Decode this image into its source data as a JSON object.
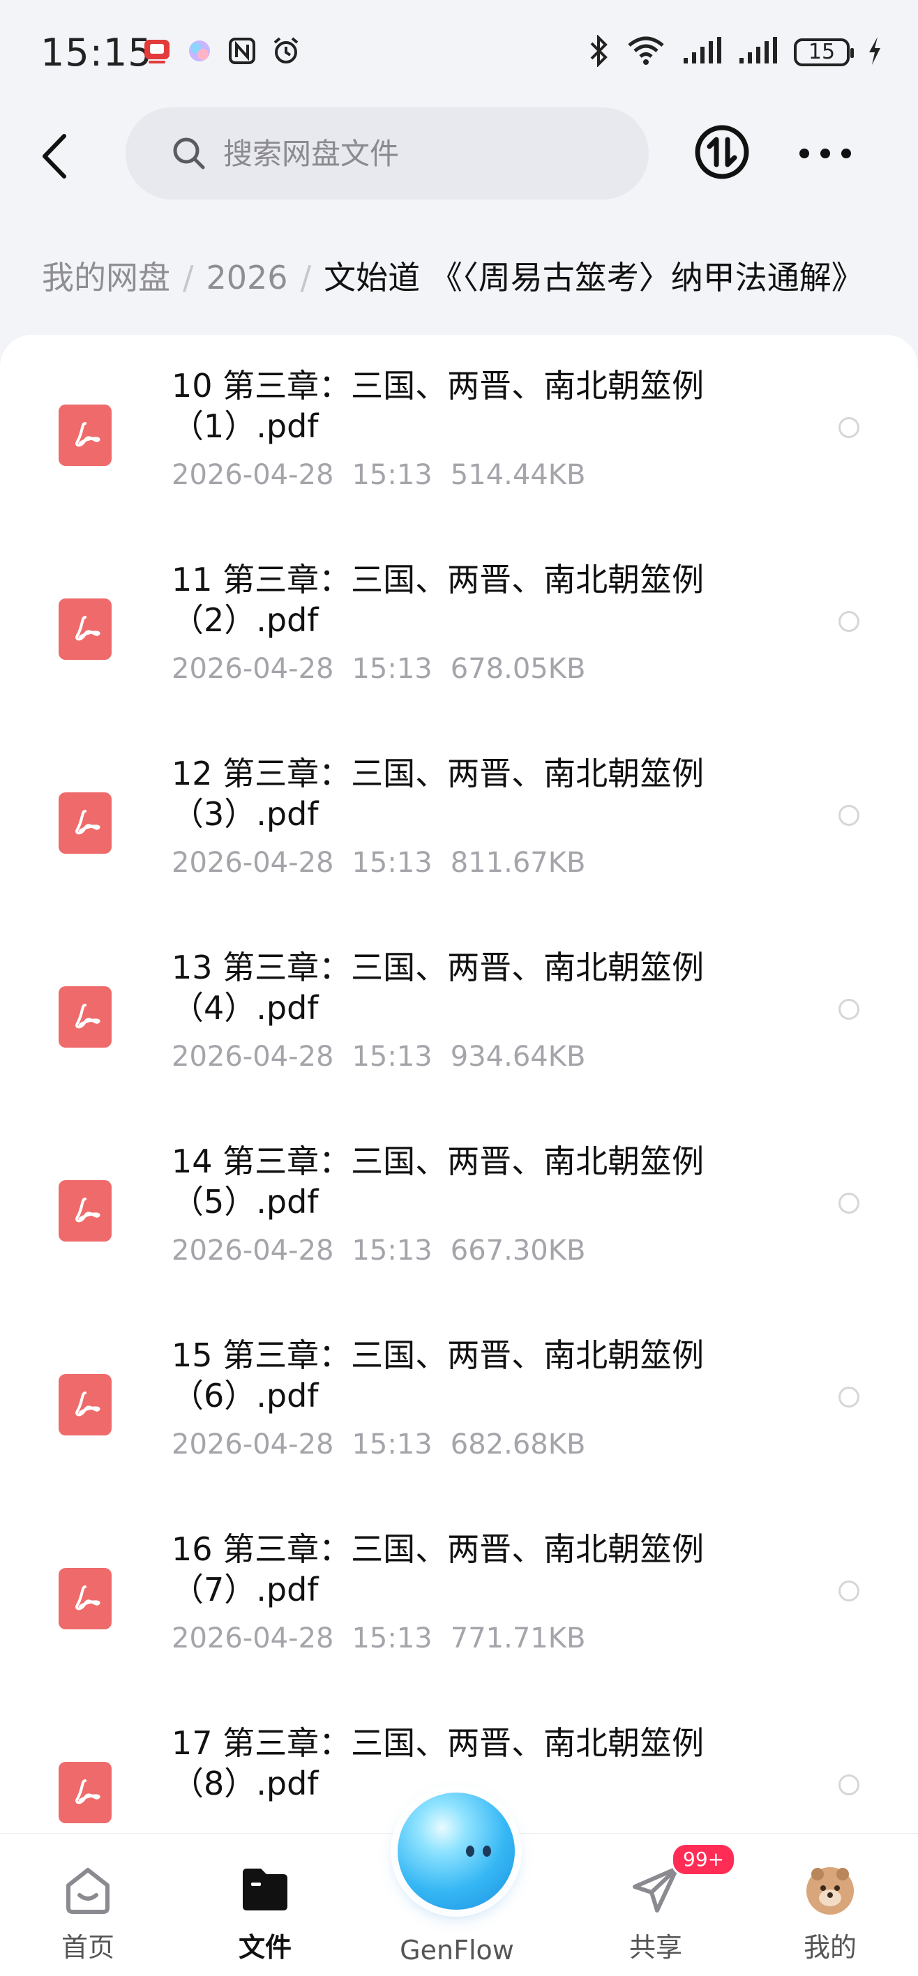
{
  "status_bar": {
    "time": "15:15",
    "battery_level": "15",
    "icons": [
      "app-notification-icon",
      "ai-assistant-icon",
      "nfc-icon",
      "alarm-icon",
      "bluetooth-icon",
      "wifi-icon",
      "signal-icon",
      "signal-icon",
      "battery-icon",
      "charging-icon"
    ]
  },
  "header": {
    "search_placeholder": "搜索网盘文件"
  },
  "breadcrumb": {
    "items": [
      "我的网盘",
      "2026"
    ],
    "current": "文始道 《〈周易古筮考〉纳甲法通解》"
  },
  "files": [
    {
      "name": "10 第三章：三国、两晋、南北朝筮例（1）.pdf",
      "date": "2026-04-28",
      "time": "15:13",
      "size": "514.44KB"
    },
    {
      "name": "11 第三章：三国、两晋、南北朝筮例（2）.pdf",
      "date": "2026-04-28",
      "time": "15:13",
      "size": "678.05KB"
    },
    {
      "name": "12 第三章：三国、两晋、南北朝筮例（3）.pdf",
      "date": "2026-04-28",
      "time": "15:13",
      "size": "811.67KB"
    },
    {
      "name": "13 第三章：三国、两晋、南北朝筮例（4）.pdf",
      "date": "2026-04-28",
      "time": "15:13",
      "size": "934.64KB"
    },
    {
      "name": "14 第三章：三国、两晋、南北朝筮例（5）.pdf",
      "date": "2026-04-28",
      "time": "15:13",
      "size": "667.30KB"
    },
    {
      "name": "15 第三章：三国、两晋、南北朝筮例（6）.pdf",
      "date": "2026-04-28",
      "time": "15:13",
      "size": "682.68KB"
    },
    {
      "name": "16 第三章：三国、两晋、南北朝筮例（7）.pdf",
      "date": "2026-04-28",
      "time": "15:13",
      "size": "771.71KB"
    },
    {
      "name": "17 第三章：三国、两晋、南北朝筮例（8）.pdf",
      "date": "",
      "time": "",
      "size": ""
    }
  ],
  "bottom_nav": {
    "home": "首页",
    "files": "文件",
    "genflow": "GenFlow",
    "share": "共享",
    "share_badge": "99+",
    "mine": "我的"
  },
  "colors": {
    "pdf_icon": "#ef6a6a",
    "badge": "#ff2d55",
    "background": "#f3f4f8"
  }
}
